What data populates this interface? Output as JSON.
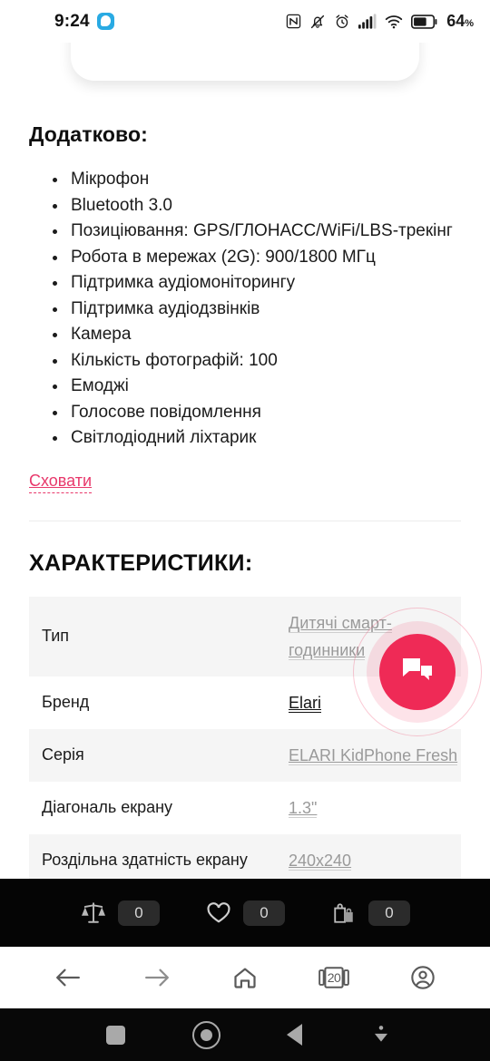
{
  "status_bar": {
    "time": "9:24",
    "battery_percent": "64",
    "battery_unit": "%",
    "icons": [
      "nfc-icon",
      "mute-icon",
      "alarm-icon",
      "signal-icon",
      "wifi-icon",
      "battery-icon"
    ]
  },
  "page": {
    "additional_title": "Додатково:",
    "features": [
      "Мікрофон",
      "Bluetooth 3.0",
      "Позиціювання: GPS/ГЛОНАСС/WiFi/LBS-трекінг",
      "Робота в мережах (2G): 900/1800 МГц",
      "Підтримка аудіомоніторингу",
      "Підтримка аудіодзвінків",
      "Камера",
      "Кількість фотографій: 100",
      "Емоджі",
      "Голосове повідомлення",
      "Світлодіодний ліхтарик"
    ],
    "hide_link": "Сховати",
    "specs_title": "ХАРАКТЕРИСТИКИ:",
    "specs": [
      {
        "label": "Тип",
        "value": "Дитячі смарт-годинники",
        "link": true,
        "dark": false
      },
      {
        "label": "Бренд",
        "value": "Elari",
        "link": true,
        "dark": true
      },
      {
        "label": "Серія",
        "value": "ELARI KidPhone Fresh",
        "link": true,
        "dark": false
      },
      {
        "label": "Діагональ екрану",
        "value": "1.3\"",
        "link": true,
        "dark": false
      },
      {
        "label": "Роздільна здатність екрану",
        "value": "240x240",
        "link": true,
        "dark": false
      }
    ]
  },
  "chat_fab": {
    "name": "chat-button",
    "color": "#EF2A56"
  },
  "shop_bar": {
    "items": [
      {
        "icon": "compare-scales-icon",
        "count": "0"
      },
      {
        "icon": "heart-icon",
        "count": "0"
      },
      {
        "icon": "shopping-bag-icon",
        "count": "0"
      }
    ]
  },
  "browser_bar": {
    "back": "back-arrow-icon",
    "forward": "forward-arrow-icon",
    "home": "home-icon",
    "tabs_count": "20",
    "profile": "profile-icon"
  },
  "android_nav": {
    "recents": "square-icon",
    "home": "circle-icon",
    "back": "triangle-icon",
    "download": "download-arrow-icon"
  }
}
